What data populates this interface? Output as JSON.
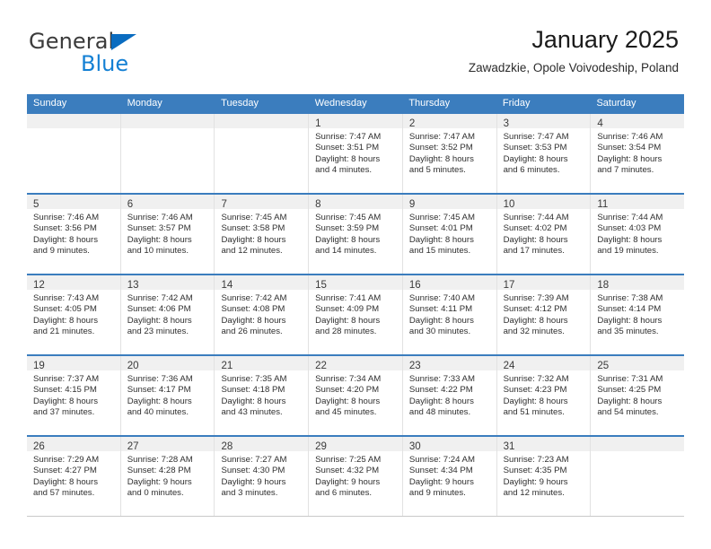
{
  "brand": {
    "name_part1": "General",
    "name_part2": "Blue",
    "triangle_color": "#0a6cc0",
    "blue_color": "#1480d4"
  },
  "header": {
    "title": "January 2025",
    "subtitle": "Zawadzkie, Opole Voivodeship, Poland"
  },
  "colors": {
    "header_blue": "#3b7dbe",
    "daynum_strip": "#f0f0f0",
    "cell_border": "#e2e2e2"
  },
  "day_headers": [
    "Sunday",
    "Monday",
    "Tuesday",
    "Wednesday",
    "Thursday",
    "Friday",
    "Saturday"
  ],
  "labels": {
    "sunrise_prefix": "Sunrise:",
    "sunset_prefix": "Sunset:",
    "daylight_prefix": "Daylight:"
  },
  "weeks": [
    [
      {
        "day": "",
        "sunrise": "",
        "sunset": "",
        "daylight_line1": "",
        "daylight_line2": ""
      },
      {
        "day": "",
        "sunrise": "",
        "sunset": "",
        "daylight_line1": "",
        "daylight_line2": ""
      },
      {
        "day": "",
        "sunrise": "",
        "sunset": "",
        "daylight_line1": "",
        "daylight_line2": ""
      },
      {
        "day": "1",
        "sunrise": "Sunrise: 7:47 AM",
        "sunset": "Sunset: 3:51 PM",
        "daylight_line1": "Daylight: 8 hours",
        "daylight_line2": "and 4 minutes."
      },
      {
        "day": "2",
        "sunrise": "Sunrise: 7:47 AM",
        "sunset": "Sunset: 3:52 PM",
        "daylight_line1": "Daylight: 8 hours",
        "daylight_line2": "and 5 minutes."
      },
      {
        "day": "3",
        "sunrise": "Sunrise: 7:47 AM",
        "sunset": "Sunset: 3:53 PM",
        "daylight_line1": "Daylight: 8 hours",
        "daylight_line2": "and 6 minutes."
      },
      {
        "day": "4",
        "sunrise": "Sunrise: 7:46 AM",
        "sunset": "Sunset: 3:54 PM",
        "daylight_line1": "Daylight: 8 hours",
        "daylight_line2": "and 7 minutes."
      }
    ],
    [
      {
        "day": "5",
        "sunrise": "Sunrise: 7:46 AM",
        "sunset": "Sunset: 3:56 PM",
        "daylight_line1": "Daylight: 8 hours",
        "daylight_line2": "and 9 minutes."
      },
      {
        "day": "6",
        "sunrise": "Sunrise: 7:46 AM",
        "sunset": "Sunset: 3:57 PM",
        "daylight_line1": "Daylight: 8 hours",
        "daylight_line2": "and 10 minutes."
      },
      {
        "day": "7",
        "sunrise": "Sunrise: 7:45 AM",
        "sunset": "Sunset: 3:58 PM",
        "daylight_line1": "Daylight: 8 hours",
        "daylight_line2": "and 12 minutes."
      },
      {
        "day": "8",
        "sunrise": "Sunrise: 7:45 AM",
        "sunset": "Sunset: 3:59 PM",
        "daylight_line1": "Daylight: 8 hours",
        "daylight_line2": "and 14 minutes."
      },
      {
        "day": "9",
        "sunrise": "Sunrise: 7:45 AM",
        "sunset": "Sunset: 4:01 PM",
        "daylight_line1": "Daylight: 8 hours",
        "daylight_line2": "and 15 minutes."
      },
      {
        "day": "10",
        "sunrise": "Sunrise: 7:44 AM",
        "sunset": "Sunset: 4:02 PM",
        "daylight_line1": "Daylight: 8 hours",
        "daylight_line2": "and 17 minutes."
      },
      {
        "day": "11",
        "sunrise": "Sunrise: 7:44 AM",
        "sunset": "Sunset: 4:03 PM",
        "daylight_line1": "Daylight: 8 hours",
        "daylight_line2": "and 19 minutes."
      }
    ],
    [
      {
        "day": "12",
        "sunrise": "Sunrise: 7:43 AM",
        "sunset": "Sunset: 4:05 PM",
        "daylight_line1": "Daylight: 8 hours",
        "daylight_line2": "and 21 minutes."
      },
      {
        "day": "13",
        "sunrise": "Sunrise: 7:42 AM",
        "sunset": "Sunset: 4:06 PM",
        "daylight_line1": "Daylight: 8 hours",
        "daylight_line2": "and 23 minutes."
      },
      {
        "day": "14",
        "sunrise": "Sunrise: 7:42 AM",
        "sunset": "Sunset: 4:08 PM",
        "daylight_line1": "Daylight: 8 hours",
        "daylight_line2": "and 26 minutes."
      },
      {
        "day": "15",
        "sunrise": "Sunrise: 7:41 AM",
        "sunset": "Sunset: 4:09 PM",
        "daylight_line1": "Daylight: 8 hours",
        "daylight_line2": "and 28 minutes."
      },
      {
        "day": "16",
        "sunrise": "Sunrise: 7:40 AM",
        "sunset": "Sunset: 4:11 PM",
        "daylight_line1": "Daylight: 8 hours",
        "daylight_line2": "and 30 minutes."
      },
      {
        "day": "17",
        "sunrise": "Sunrise: 7:39 AM",
        "sunset": "Sunset: 4:12 PM",
        "daylight_line1": "Daylight: 8 hours",
        "daylight_line2": "and 32 minutes."
      },
      {
        "day": "18",
        "sunrise": "Sunrise: 7:38 AM",
        "sunset": "Sunset: 4:14 PM",
        "daylight_line1": "Daylight: 8 hours",
        "daylight_line2": "and 35 minutes."
      }
    ],
    [
      {
        "day": "19",
        "sunrise": "Sunrise: 7:37 AM",
        "sunset": "Sunset: 4:15 PM",
        "daylight_line1": "Daylight: 8 hours",
        "daylight_line2": "and 37 minutes."
      },
      {
        "day": "20",
        "sunrise": "Sunrise: 7:36 AM",
        "sunset": "Sunset: 4:17 PM",
        "daylight_line1": "Daylight: 8 hours",
        "daylight_line2": "and 40 minutes."
      },
      {
        "day": "21",
        "sunrise": "Sunrise: 7:35 AM",
        "sunset": "Sunset: 4:18 PM",
        "daylight_line1": "Daylight: 8 hours",
        "daylight_line2": "and 43 minutes."
      },
      {
        "day": "22",
        "sunrise": "Sunrise: 7:34 AM",
        "sunset": "Sunset: 4:20 PM",
        "daylight_line1": "Daylight: 8 hours",
        "daylight_line2": "and 45 minutes."
      },
      {
        "day": "23",
        "sunrise": "Sunrise: 7:33 AM",
        "sunset": "Sunset: 4:22 PM",
        "daylight_line1": "Daylight: 8 hours",
        "daylight_line2": "and 48 minutes."
      },
      {
        "day": "24",
        "sunrise": "Sunrise: 7:32 AM",
        "sunset": "Sunset: 4:23 PM",
        "daylight_line1": "Daylight: 8 hours",
        "daylight_line2": "and 51 minutes."
      },
      {
        "day": "25",
        "sunrise": "Sunrise: 7:31 AM",
        "sunset": "Sunset: 4:25 PM",
        "daylight_line1": "Daylight: 8 hours",
        "daylight_line2": "and 54 minutes."
      }
    ],
    [
      {
        "day": "26",
        "sunrise": "Sunrise: 7:29 AM",
        "sunset": "Sunset: 4:27 PM",
        "daylight_line1": "Daylight: 8 hours",
        "daylight_line2": "and 57 minutes."
      },
      {
        "day": "27",
        "sunrise": "Sunrise: 7:28 AM",
        "sunset": "Sunset: 4:28 PM",
        "daylight_line1": "Daylight: 9 hours",
        "daylight_line2": "and 0 minutes."
      },
      {
        "day": "28",
        "sunrise": "Sunrise: 7:27 AM",
        "sunset": "Sunset: 4:30 PM",
        "daylight_line1": "Daylight: 9 hours",
        "daylight_line2": "and 3 minutes."
      },
      {
        "day": "29",
        "sunrise": "Sunrise: 7:25 AM",
        "sunset": "Sunset: 4:32 PM",
        "daylight_line1": "Daylight: 9 hours",
        "daylight_line2": "and 6 minutes."
      },
      {
        "day": "30",
        "sunrise": "Sunrise: 7:24 AM",
        "sunset": "Sunset: 4:34 PM",
        "daylight_line1": "Daylight: 9 hours",
        "daylight_line2": "and 9 minutes."
      },
      {
        "day": "31",
        "sunrise": "Sunrise: 7:23 AM",
        "sunset": "Sunset: 4:35 PM",
        "daylight_line1": "Daylight: 9 hours",
        "daylight_line2": "and 12 minutes."
      },
      {
        "day": "",
        "sunrise": "",
        "sunset": "",
        "daylight_line1": "",
        "daylight_line2": ""
      }
    ]
  ]
}
